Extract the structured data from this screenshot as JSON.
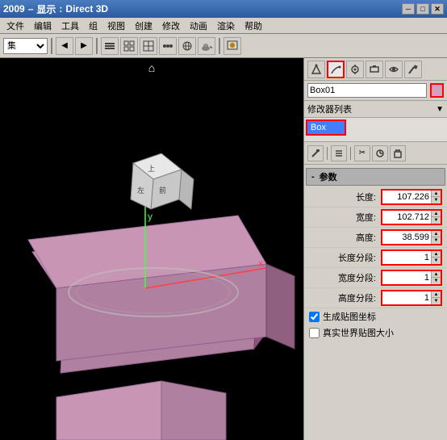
{
  "title": {
    "year": "2009",
    "separator": "–",
    "menu_label": "显示",
    "colon": ":",
    "mode": "Direct 3D"
  },
  "title_buttons": {
    "minimize": "─",
    "maximize": "□",
    "close": "✕"
  },
  "toolbar": {
    "select_value": "集",
    "buttons": [
      "◀",
      "▶",
      "◈",
      "▦",
      "▣",
      "⋯",
      "⊕",
      "🍵"
    ]
  },
  "viewport": {
    "label": "",
    "home_icon": "⌂"
  },
  "right_panel": {
    "toolbar_buttons": [
      "⟲",
      "∿",
      "👤",
      "⊡",
      "🔧"
    ],
    "name_field": "Box01",
    "color_swatch": "#d4a0c0",
    "modifier_section_label": "修改器列表",
    "modifier_item": "Box",
    "toolbar2_buttons": [
      "⊢",
      "‖",
      "✂",
      "⊘",
      "⊡"
    ],
    "params_header": "参数",
    "params_minus": "-",
    "parameters": [
      {
        "label": "长度:",
        "value": "107.226",
        "has_red_border": true
      },
      {
        "label": "宽度:",
        "value": "102.712",
        "has_red_border": true
      },
      {
        "label": "高度:",
        "value": "38.599",
        "has_red_border": true
      },
      {
        "label": "长度分段:",
        "value": "1",
        "has_red_border": true
      },
      {
        "label": "宽度分段:",
        "value": "1",
        "has_red_border": true
      },
      {
        "label": "高度分段:",
        "value": "1",
        "has_red_border": true
      }
    ],
    "checkbox1_label": "✓ 生成贴图坐标",
    "checkbox2_label": "□ 真实世界贴图大小"
  }
}
